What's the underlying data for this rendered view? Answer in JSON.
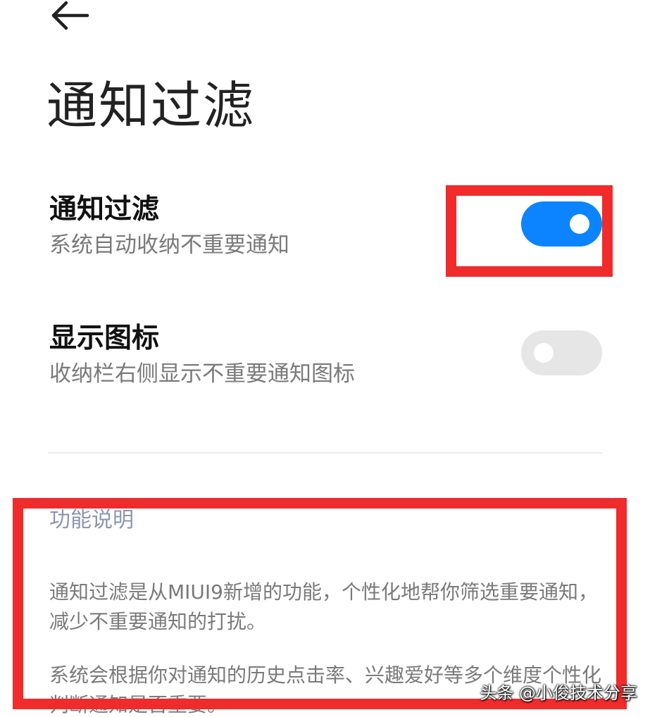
{
  "header": {
    "back_icon": "arrow-left-icon",
    "title": "通知过滤"
  },
  "settings": [
    {
      "title": "通知过滤",
      "subtitle": "系统自动收纳不重要通知",
      "enabled": true
    },
    {
      "title": "显示图标",
      "subtitle": "收纳栏右侧显示不重要通知图标",
      "enabled": false
    }
  ],
  "description": {
    "title": "功能说明",
    "paragraph_1": "通知过滤是从MIUI9新增的功能，个性化地帮你筛选重要通知，减少不重要通知的打扰。",
    "paragraph_2": "系统会根据你对通知的历史点击率、兴趣爱好等多个维度个性化判断通知是否重要。"
  },
  "watermark": "头条 @小俊技术分享",
  "colors": {
    "toggle_on": "#0d84ff",
    "toggle_off": "#e6e6e6",
    "highlight_box": "#f02b2b",
    "section_title": "#8b96b0"
  }
}
